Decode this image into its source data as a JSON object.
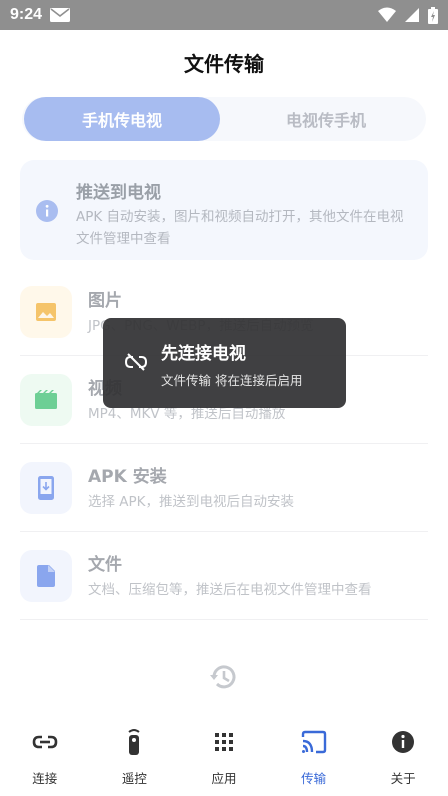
{
  "status_bar": {
    "time": "9:24"
  },
  "header": {
    "title": "文件传输"
  },
  "tabs": [
    {
      "label": "手机传电视",
      "active": true
    },
    {
      "label": "电视传手机",
      "active": false
    }
  ],
  "info": {
    "title": "推送到电视",
    "description": "APK 自动安装，图片和视频自动打开，其他文件在电视文件管理中查看"
  },
  "items": [
    {
      "title": "图片",
      "description": "JPG、PNG、WEBP，推送后自动预览",
      "icon": "image-icon",
      "color": "#f5c46a"
    },
    {
      "title": "视频",
      "description": "MP4、MKV 等，推送后自动播放",
      "icon": "movie-icon",
      "color": "#6dcf95"
    },
    {
      "title": "APK 安装",
      "description": "选择 APK，推送到电视后自动安装",
      "icon": "install-icon",
      "color": "#8aa6ee"
    },
    {
      "title": "文件",
      "description": "文档、压缩包等，推送后在电视文件管理中查看",
      "icon": "file-icon",
      "color": "#8aa6ee"
    }
  ],
  "toast": {
    "title": "先连接电视",
    "subtitle": "文件传输 将在连接后启用"
  },
  "bottom_nav": [
    {
      "label": "连接",
      "icon": "link-icon"
    },
    {
      "label": "遥控",
      "icon": "remote-icon"
    },
    {
      "label": "应用",
      "icon": "apps-grid-icon"
    },
    {
      "label": "传输",
      "icon": "cast-icon",
      "active": true
    },
    {
      "label": "关于",
      "icon": "info-icon"
    }
  ],
  "colors": {
    "accent": "#3a6ad8",
    "tab_active": "#a7bcf0",
    "toast_bg": "#323234"
  }
}
